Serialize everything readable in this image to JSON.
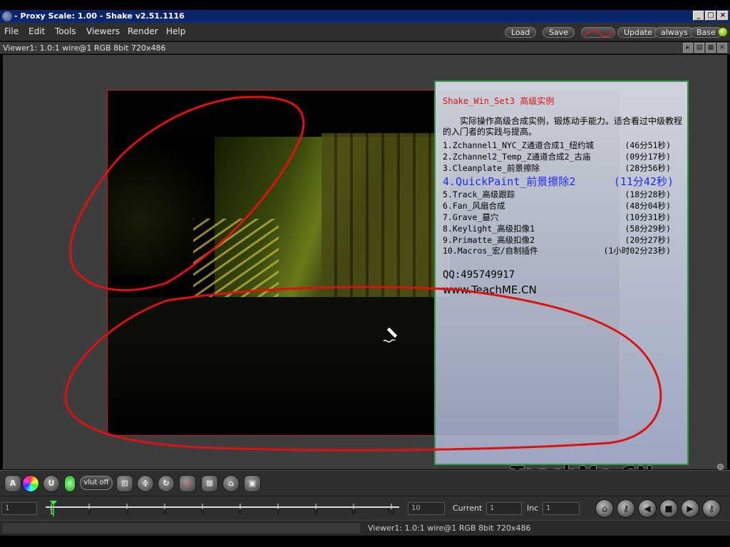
{
  "window": {
    "title": "- Proxy Scale: 1.00 - Shake v2.51.1116",
    "minimize": "_",
    "maximize": "□",
    "close": "×"
  },
  "menu": [
    "File",
    "Edit",
    "Tools",
    "Viewers",
    "Render",
    "Help"
  ],
  "topbuttons": {
    "load": "Load",
    "save": "Save",
    "update": "Update",
    "always": "always",
    "base": "Base"
  },
  "viewer": {
    "title": "Viewer1: 1.0:1 wire@1 RGB 8bit 720x486"
  },
  "overlay": {
    "title": "Shake_Win_Set3 高级实例",
    "intro": "实际操作高级合成实例，锻炼动手能力。适合看过中级教程的入门者的实践与提高。",
    "lessons": [
      {
        "name": "1.Zchannel1_NYC_Z通道合成1_纽约城",
        "dur": "(46分51秒)"
      },
      {
        "name": "2.Zchannel2_Temp_Z通道合成2_古庙",
        "dur": "(09分17秒)"
      },
      {
        "name": "3.Cleanplate_前景擦除",
        "dur": "(28分56秒)"
      },
      {
        "name": "4.QuickPaint_前景擦除2",
        "dur": "(11分42秒)"
      },
      {
        "name": "5.Track_高级跟踪",
        "dur": "(18分28秒)"
      },
      {
        "name": "6.Fan_风扇合成",
        "dur": "(48分04秒)"
      },
      {
        "name": "7.Grave_墓穴",
        "dur": "(10分31秒)"
      },
      {
        "name": "8.Keylight_高级扣像1",
        "dur": "(58分29秒)"
      },
      {
        "name": "9.Primatte_高级扣像2",
        "dur": "(20分27秒)"
      },
      {
        "name": "10.Macros_宏/自制插件",
        "dur": "(1小时02分23秒)"
      }
    ],
    "qq": "QQ:495749917",
    "website": "www.TeachME.CN"
  },
  "watermark": "TeachMe.CN",
  "toolbar": {
    "a_label": "A",
    "u_label": "U",
    "vlut": "vlut off"
  },
  "timeline": {
    "start": "1",
    "end": "10",
    "current_label": "Current",
    "current": "1",
    "inc_label": "Inc",
    "inc": "1",
    "ticks": [
      "1",
      "2",
      "3",
      "4",
      "5",
      "6",
      "7",
      "8",
      "9",
      "10"
    ]
  },
  "status": {
    "text": "Viewer1: 1.0:1 wire@1 RGB 8bit 720x486"
  },
  "colors": {
    "annotation_red": "#e01010",
    "panel_border": "#2e9a42",
    "highlight_blue": "#1c2cf0"
  }
}
